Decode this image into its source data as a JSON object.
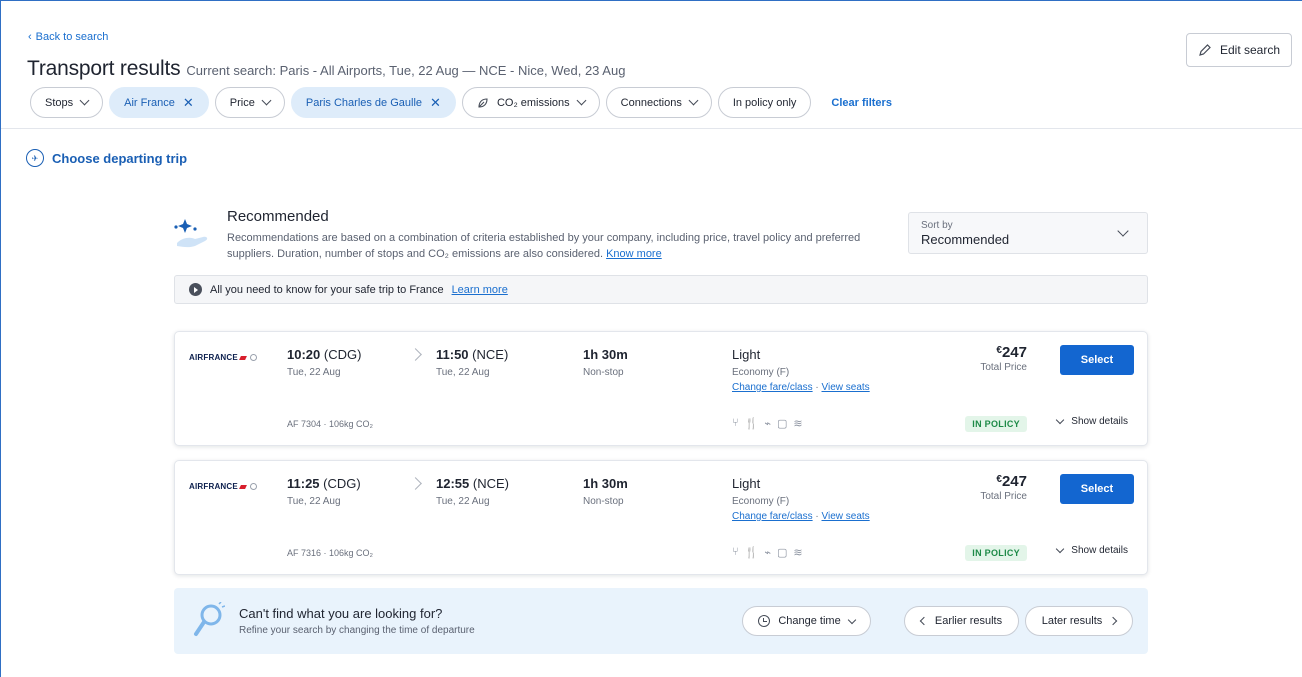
{
  "header": {
    "back_label": "Back to search",
    "title": "Transport results",
    "current_search": "Current search: Paris - All Airports, Tue, 22 Aug — NCE - Nice, Wed, 23 Aug",
    "edit_search_label": "Edit search"
  },
  "filters": {
    "items": [
      {
        "label": "Stops",
        "active": false
      },
      {
        "label": "Air France",
        "active": true
      },
      {
        "label": "Price",
        "active": false
      },
      {
        "label": "Paris Charles de Gaulle",
        "active": true
      },
      {
        "label": "CO₂ emissions",
        "active": false
      },
      {
        "label": "Connections",
        "active": false
      },
      {
        "label": "In policy only",
        "active": false
      }
    ],
    "clear_label": "Clear filters"
  },
  "choose_trip_label": "Choose departing trip",
  "recommended": {
    "title": "Recommended",
    "description": "Recommendations are based on a combination of criteria established by your company, including price, travel policy and preferred suppliers. Duration, number of stops and CO₂ emissions are also considered.",
    "know_more": "Know more"
  },
  "sort": {
    "label": "Sort by",
    "value": "Recommended"
  },
  "info_bar": {
    "text": "All you need to know for your safe trip to France",
    "link": "Learn more"
  },
  "results": [
    {
      "airline": "AIRFRANCE",
      "dep_time": "10:20",
      "dep_code": "(CDG)",
      "dep_date": "Tue, 22 Aug",
      "arr_time": "11:50",
      "arr_code": "(NCE)",
      "arr_date": "Tue, 22 Aug",
      "duration": "1h 30m",
      "stops": "Non-stop",
      "fare": "Light",
      "cabin": "Economy (F)",
      "change_fare": "Change fare/class",
      "link_sep": " · ",
      "view_seats": "View seats",
      "currency": "€",
      "price": "247",
      "price_label": "Total Price",
      "select_label": "Select",
      "flight_info": "AF 7304 · 106kg CO₂",
      "policy": "IN POLICY",
      "details_label": "Show details"
    },
    {
      "airline": "AIRFRANCE",
      "dep_time": "11:25",
      "dep_code": "(CDG)",
      "dep_date": "Tue, 22 Aug",
      "arr_time": "12:55",
      "arr_code": "(NCE)",
      "arr_date": "Tue, 22 Aug",
      "duration": "1h 30m",
      "stops": "Non-stop",
      "fare": "Light",
      "cabin": "Economy (F)",
      "change_fare": "Change fare/class",
      "link_sep": " · ",
      "view_seats": "View seats",
      "currency": "€",
      "price": "247",
      "price_label": "Total Price",
      "select_label": "Select",
      "flight_info": "AF 7316 · 106kg CO₂",
      "policy": "IN POLICY",
      "details_label": "Show details"
    }
  ],
  "cant_find": {
    "title": "Can't find what you are looking for?",
    "subtitle": "Refine your search by changing the time of departure",
    "change_time": "Change time",
    "earlier": "Earlier results",
    "later": "Later results"
  },
  "colors": {
    "accent": "#1366d0",
    "link": "#1a6fcf",
    "active_chip_bg": "#deecfa",
    "policy_green": "#1d8a47"
  }
}
